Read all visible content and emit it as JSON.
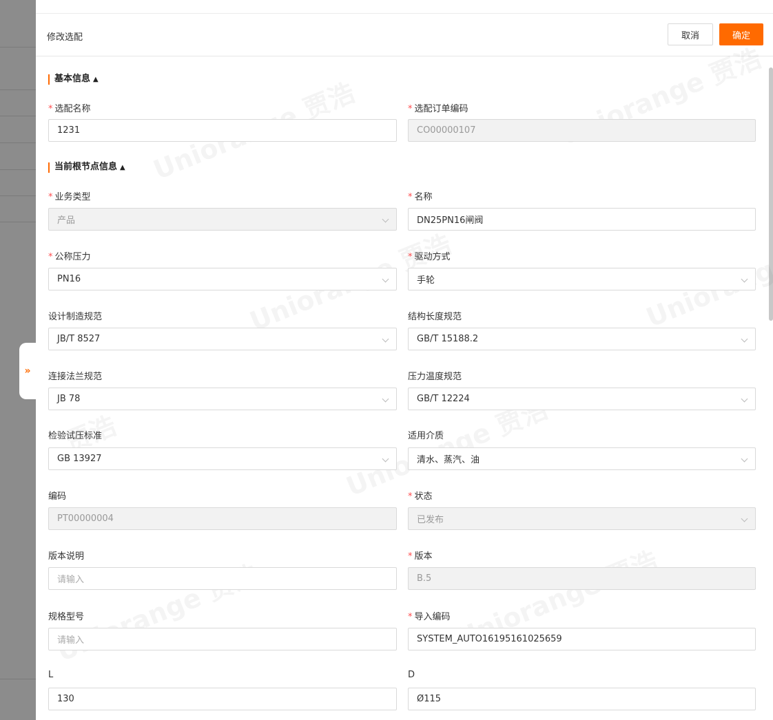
{
  "dialog": {
    "title": "修改选配",
    "cancel_label": "取消",
    "ok_label": "确定"
  },
  "sections": {
    "basic": "基本信息",
    "root": "当前根节点信息"
  },
  "side_toggle": "»",
  "fields": {
    "config_name": {
      "label": "选配名称",
      "value": "1231"
    },
    "order_code": {
      "label": "选配订单编码",
      "value": "CO00000107"
    },
    "business_type": {
      "label": "业务类型",
      "value": "产品"
    },
    "name": {
      "label": "名称",
      "value": "DN25PN16闸阀"
    },
    "nominal_pressure": {
      "label": "公称压力",
      "value": "PN16"
    },
    "drive_mode": {
      "label": "驱动方式",
      "value": "手轮"
    },
    "design_spec": {
      "label": "设计制造规范",
      "value": "JB/T 8527"
    },
    "length_spec": {
      "label": "结构长度规范",
      "value": "GB/T 15188.2"
    },
    "flange_spec": {
      "label": "连接法兰规范",
      "value": "JB 78"
    },
    "pt_spec": {
      "label": "压力温度规范",
      "value": "GB/T 12224"
    },
    "test_std": {
      "label": "检验试压标准",
      "value": "GB 13927"
    },
    "medium": {
      "label": "适用介质",
      "value": "清水、蒸汽、油"
    },
    "code": {
      "label": "编码",
      "value": "PT00000004"
    },
    "status": {
      "label": "状态",
      "value": "已发布"
    },
    "version_note": {
      "label": "版本说明",
      "placeholder": "请输入"
    },
    "version": {
      "label": "版本",
      "value": "B.5"
    },
    "model": {
      "label": "规格型号",
      "placeholder": "请输入"
    },
    "import_code": {
      "label": "导入编码",
      "value": "SYSTEM_AUTO16195161025659"
    },
    "L": {
      "label": "L",
      "value": "130"
    },
    "D": {
      "label": "D",
      "value": "Ø115"
    }
  },
  "watermark": {
    "text1": "Uniorange",
    "text2": "贾浩"
  }
}
